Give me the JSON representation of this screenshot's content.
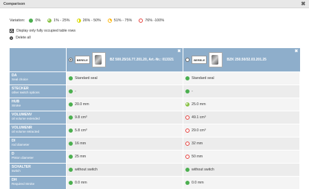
{
  "window": {
    "title": "Comparison",
    "close_label": "✖"
  },
  "legend": {
    "label": "Variation:",
    "items": [
      {
        "label": "0%",
        "color": "#4caf50"
      },
      {
        "label": "1% - 25%",
        "color": "#8bc34a"
      },
      {
        "label": "26% - 50%",
        "color": "#e6e600"
      },
      {
        "label": "51% - 75%",
        "color": "#ffb300"
      },
      {
        "label": "76% -100%",
        "color": "#e53935"
      }
    ]
  },
  "options": {
    "only_fully_occupied_label": "Display only fully occupied table rows",
    "delete_all_label": "Delete all"
  },
  "products": [
    {
      "logo": "BERELE",
      "title": "BZ 500.25/16.77.201.20, Art.-Nr.: 013321",
      "selected": true,
      "close": "✖"
    },
    {
      "logo": "BERELE",
      "title": "BZK 250.50/32.03.201.25",
      "selected": false,
      "close": "✖"
    }
  ],
  "rows": [
    {
      "code": "DA",
      "desc": "Seal choice",
      "values": [
        {
          "text": "Standard seal",
          "icon": "full"
        },
        {
          "text": "Standard seal",
          "icon": "full"
        }
      ]
    },
    {
      "code": "STECKER",
      "desc": "other switch options",
      "values": [
        {
          "text": "-",
          "icon": "full"
        },
        {
          "text": "-",
          "icon": "full"
        }
      ]
    },
    {
      "code": "HUB",
      "desc": "Stroke",
      "values": [
        {
          "text": "20.0 mm",
          "icon": "full"
        },
        {
          "text": "25.0 mm",
          "icon": "partial"
        }
      ]
    },
    {
      "code": "VOLUMENV",
      "desc": "oil volume extended",
      "values": [
        {
          "text": "9.8 cm³",
          "icon": "full"
        },
        {
          "text": "49.1 cm³",
          "icon": "empty"
        }
      ]
    },
    {
      "code": "VOLUMENR",
      "desc": "oil volume retracted",
      "values": [
        {
          "text": "5.8 cm³",
          "icon": "full"
        },
        {
          "text": "29.0 cm³",
          "icon": "empty"
        }
      ]
    },
    {
      "code": "DI",
      "desc": "rod diameter",
      "values": [
        {
          "text": "16 mm",
          "icon": "full"
        },
        {
          "text": "32 mm",
          "icon": "empty"
        }
      ]
    },
    {
      "code": "D",
      "desc": "Piston diameter",
      "values": [
        {
          "text": "25 mm",
          "icon": "full"
        },
        {
          "text": "50 mm",
          "icon": "empty"
        }
      ]
    },
    {
      "code": "SCHALTER",
      "desc": "switch",
      "values": [
        {
          "text": "without switch",
          "icon": "full"
        },
        {
          "text": "without switch",
          "icon": "full"
        }
      ]
    },
    {
      "code": "DH",
      "desc": "Required Stroke",
      "values": [
        {
          "text": "0.0 mm",
          "icon": "full"
        },
        {
          "text": "0.0 mm",
          "icon": "full"
        }
      ]
    }
  ]
}
